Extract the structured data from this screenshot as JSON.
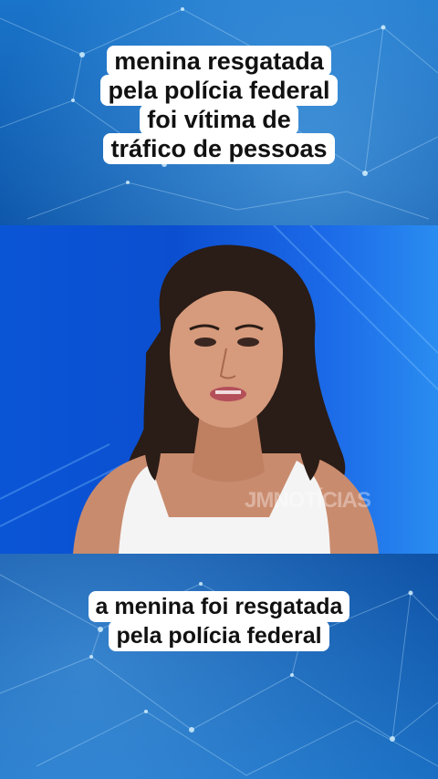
{
  "top_caption": {
    "lines": [
      "menina resgatada",
      "pela polícia federal",
      "foi vítima de",
      "tráfico de pessoas"
    ]
  },
  "bottom_caption": {
    "lines": [
      "a menina foi resgatada",
      "pela polícia federal"
    ]
  },
  "video": {
    "watermark": "JMNOTÍCIAS"
  },
  "colors": {
    "caption_bg": "#ffffff",
    "caption_text": "#111111",
    "video_bg": "#0b4fd0"
  }
}
